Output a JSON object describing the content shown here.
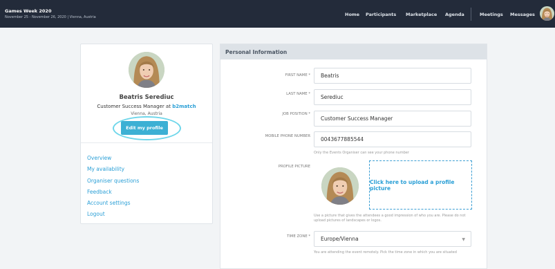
{
  "event": {
    "title": "Games Week 2020",
    "subtitle": "November 25 - November 26, 2020 | Vienna, Austria"
  },
  "nav": {
    "items": [
      "Home",
      "Participants",
      "Marketplace",
      "Agenda"
    ],
    "right_items": [
      "Meetings",
      "Messages"
    ]
  },
  "profile": {
    "name": "Beatris Serediuc",
    "role_prefix": "Customer Success Manager at",
    "company": "b2match",
    "location": "Vienna, Austria",
    "edit_button": "Edit my profile",
    "menu": [
      "Overview",
      "My availability",
      "Organiser questions",
      "Feedback",
      "Account settings",
      "Logout"
    ]
  },
  "form": {
    "section_title": "Personal Information",
    "first_name": {
      "label": "FIRST NAME *",
      "value": "Beatris"
    },
    "last_name": {
      "label": "LAST NAME *",
      "value": "Serediuc"
    },
    "job_position": {
      "label": "JOB POSITION *",
      "value": "Customer Success Manager"
    },
    "mobile_phone": {
      "label": "MOBILE PHONE NUMBER",
      "value": "0043677885544",
      "help": "Only the Events Organiser can see your phone number"
    },
    "profile_picture": {
      "label": "PROFILE PICTURE",
      "upload_text": "Click here to upload a profile picture",
      "help": "Use a picture that gives the attendees a good impression of who you are. Please do not upload pictures of landscapes or logos."
    },
    "time_zone": {
      "label": "TIME ZONE *",
      "value": "Europe/Vienna",
      "help": "You are attending the event remotely. Pick the time zone in which you are situated"
    }
  },
  "colors": {
    "topbar": "#232b3a",
    "accent": "#2a9fd6",
    "button": "#3cb0d4",
    "highlight": "#6ed6ea"
  }
}
